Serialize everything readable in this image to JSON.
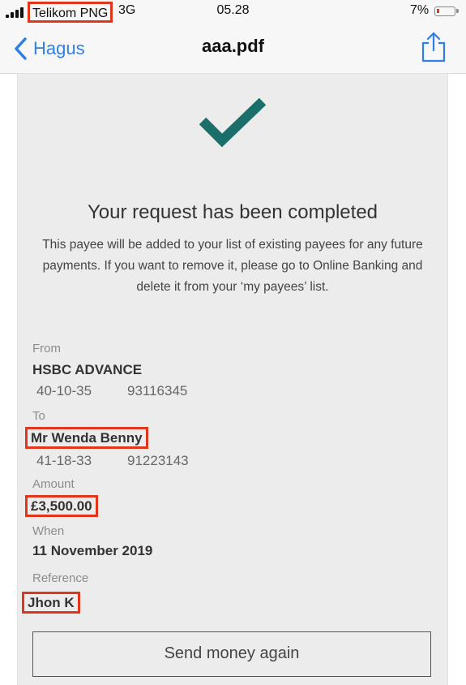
{
  "status_bar": {
    "carrier": "Telikom PNG",
    "network": "3G",
    "time": "05.28",
    "battery_percent": "7%",
    "battery_level": 0.07,
    "highlight_color": "#e0361b"
  },
  "nav": {
    "back_label": "Hagus",
    "title": "aaa.pdf",
    "back_icon": "chevron-left-icon",
    "share_icon": "share-icon",
    "accent_color": "#2f7ee6"
  },
  "confirmation": {
    "icon": "checkmark-icon",
    "icon_color": "#1b6f6a",
    "headline": "Your request has been completed",
    "description": "This payee will be added to your list of existing payees for any future payments. If you want to remove it, please go to Online Banking and delete it from your ‘my payees’ list."
  },
  "details": {
    "from_label": "From",
    "from_name": "HSBC ADVANCE",
    "from_sort_code": "40-10-35",
    "from_account": "93116345",
    "to_label": "To",
    "to_name": "Mr Wenda Benny",
    "to_sort_code": "41-18-33",
    "to_account": "91223143",
    "amount_label": "Amount",
    "amount": "£3,500.00",
    "when_label": "When",
    "when": "11 November 2019",
    "reference_label": "Reference",
    "reference": "Jhon K"
  },
  "actions": {
    "send_again": "Send money again"
  }
}
